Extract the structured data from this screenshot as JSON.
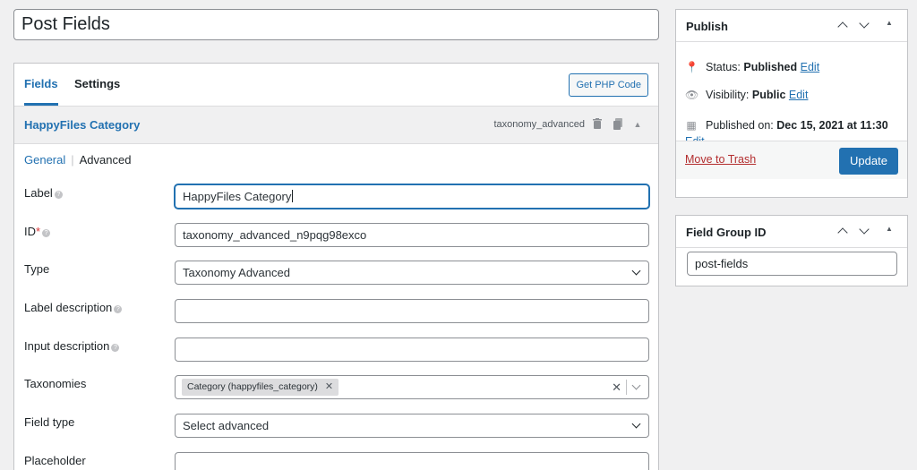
{
  "post_title": "Post Fields",
  "tabs": {
    "fields": "Fields",
    "settings": "Settings"
  },
  "get_php_code": "Get PHP Code",
  "field": {
    "name": "HappyFiles Category",
    "type_slug": "taxonomy_advanced",
    "subtabs": {
      "general": "General",
      "advanced": "Advanced"
    },
    "rows": {
      "label": {
        "label": "Label",
        "value": "HappyFiles Category"
      },
      "id": {
        "label": "ID",
        "required_mark": "*",
        "value": "taxonomy_advanced_n9pqg98exco"
      },
      "type": {
        "label": "Type",
        "value": "Taxonomy Advanced"
      },
      "label_description": {
        "label": "Label description",
        "value": ""
      },
      "input_description": {
        "label": "Input description",
        "value": ""
      },
      "taxonomies": {
        "label": "Taxonomies",
        "chip": "Category (happyfiles_category)"
      },
      "field_type": {
        "label": "Field type",
        "value": "Select advanced"
      },
      "placeholder": {
        "label": "Placeholder",
        "value": ""
      }
    }
  },
  "publish": {
    "title": "Publish",
    "status_label": "Status:",
    "status_value": "Published",
    "visibility_label": "Visibility:",
    "visibility_value": "Public",
    "published_on_label": "Published on:",
    "published_on_value": "Dec 15, 2021 at 11:30",
    "edit": "Edit",
    "move_to_trash": "Move to Trash",
    "update": "Update"
  },
  "field_group_id": {
    "title": "Field Group ID",
    "value": "post-fields"
  },
  "colors": {
    "accent": "#2271b1",
    "danger": "#b32d2e",
    "background": "#f0f0f1"
  }
}
